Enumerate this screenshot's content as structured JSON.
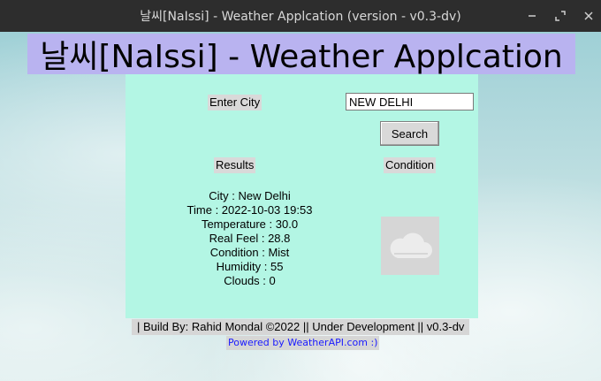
{
  "window": {
    "title": "날씨[NaIssi] - Weather Applcation (version - v0.3-dv)",
    "minimize_glyph": "—",
    "maximize_glyph": "⤢",
    "close_glyph": "✕"
  },
  "header": {
    "app_title": "날씨[NaIssi] - Weather Applcation"
  },
  "search": {
    "label": "Enter City",
    "value": "NEW DELHI",
    "button_label": "Search"
  },
  "sections": {
    "results_label": "Results",
    "condition_label": "Condition"
  },
  "results": {
    "city": "City : New Delhi",
    "time": "Time : 2022-10-03 19:53",
    "temperature": "Temperature : 30.0",
    "real_feel": "Real Feel : 28.8",
    "condition": "Condition : Mist",
    "humidity": "Humidity : 55",
    "clouds": "Clouds : 0"
  },
  "condition_icon": "cloud-icon",
  "footer": {
    "build_text": "| Build By: Rahid Mondal ©2022 || Under Development || v0.3-dv",
    "powered_text": "Powered by WeatherAPI.com :)"
  },
  "colors": {
    "title_bg": "#b9b3f0",
    "panel_bg": "#b3f6e4",
    "link": "#1a1aff"
  }
}
